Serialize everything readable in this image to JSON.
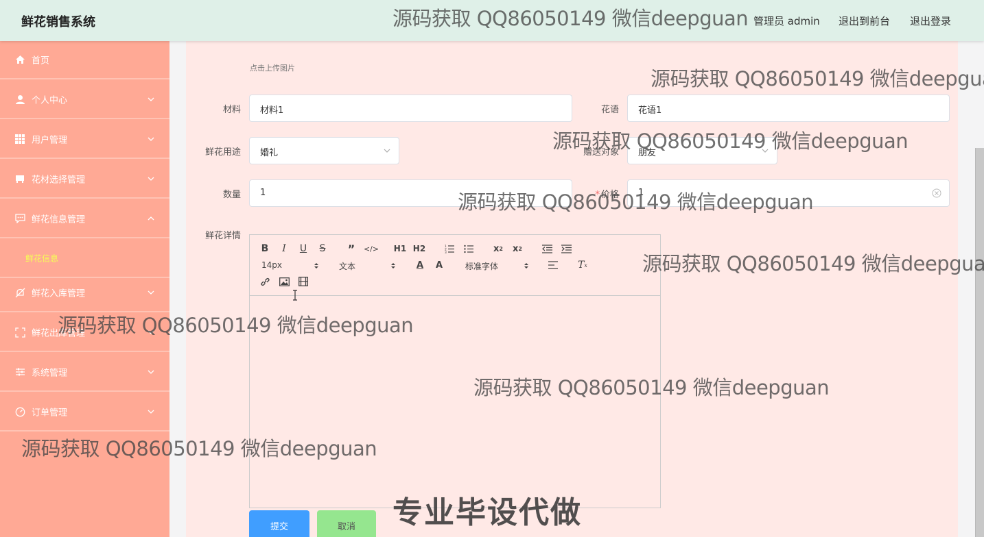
{
  "header": {
    "title": "鲜花销售系统",
    "user_label": "管理员 admin",
    "front_link": "退出到前台",
    "logout_link": "退出登录"
  },
  "sidebar": {
    "items": [
      {
        "label": "首页",
        "icon": "home-icon"
      },
      {
        "label": "个人中心",
        "icon": "user-icon"
      },
      {
        "label": "用户管理",
        "icon": "grid-icon"
      },
      {
        "label": "花材选择管理",
        "icon": "box-icon"
      },
      {
        "label": "鲜花信息管理",
        "icon": "chat-icon"
      },
      {
        "label": "鲜花入库管理",
        "icon": "bell-off-icon"
      },
      {
        "label": "鲜花出库管理",
        "icon": "frame-icon"
      },
      {
        "label": "系统管理",
        "icon": "sliders-icon"
      },
      {
        "label": "订单管理",
        "icon": "gauge-icon"
      }
    ],
    "sub_item": "鲜花信息"
  },
  "form": {
    "upload_hint": "点击上传图片",
    "material": {
      "label": "材料",
      "value": "材料1"
    },
    "flower_language": {
      "label": "花语",
      "value": "花语1"
    },
    "usage": {
      "label": "鲜花用途",
      "value": "婚礼"
    },
    "recipient": {
      "label": "赠送对象",
      "value": "朋友"
    },
    "quantity": {
      "label": "数量",
      "value": "1"
    },
    "price": {
      "label": "价格",
      "value": "1"
    },
    "details_label": "鲜花详情"
  },
  "editor": {
    "font_size": "14px",
    "heading": "文本",
    "font_family": "标准字体",
    "h1": "H1",
    "h2": "H2"
  },
  "buttons": {
    "submit": "提交",
    "cancel": "取消"
  },
  "watermarks": {
    "text": "源码获取 QQ86050149 微信deepguan",
    "big": "专业毕设代做"
  }
}
